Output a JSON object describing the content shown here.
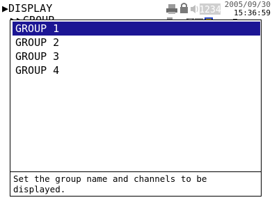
{
  "header": {
    "path_line1": "▶DISPLAY",
    "path_line2": "▶▶GROUP",
    "date": "2005/09/30",
    "time": "15:36:59",
    "memory_indicator": "1234",
    "icons": [
      "printer-icon",
      "lock-icon",
      "speaker-icon",
      "network-icon",
      "usb-icon",
      "floppy-icon",
      "monitor-icon",
      "settings-icon",
      "card-icon",
      "battery-icon",
      "keyboard-icon",
      "mouse-icon"
    ]
  },
  "groups": {
    "items": [
      {
        "label": "GROUP 1",
        "selected": true
      },
      {
        "label": "GROUP 2",
        "selected": false
      },
      {
        "label": "GROUP 3",
        "selected": false
      },
      {
        "label": "GROUP 4",
        "selected": false
      }
    ]
  },
  "message": {
    "text": "Set the group name and channels to be\ndisplayed."
  },
  "colors": {
    "selection": "#1c1694",
    "selection_text": "#ffffff"
  }
}
